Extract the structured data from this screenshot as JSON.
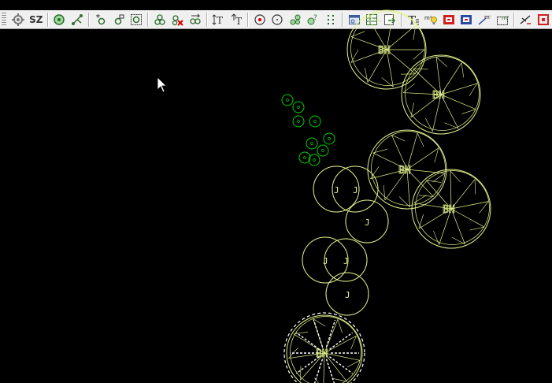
{
  "toolbar": {
    "sz_label": "SZ",
    "buttons": [
      "settings-icon",
      "sz-text",
      "green-circle-icon",
      "branch-icon",
      "tree-add-icon",
      "tree-edit-icon",
      "tree-frame-icon",
      "tree-group-icon",
      "tree-delete-icon",
      "tree-move-icon",
      "text-height-icon",
      "text-width-icon",
      "circle-red-icon",
      "circle-plain-icon",
      "tree-cluster-icon",
      "tree-help-icon",
      "grid-icon",
      "window-icon",
      "table-icon",
      "export-icon",
      "text-style-icon",
      "area-bulb-icon",
      "red-block-icon",
      "blue-block-icon",
      "area-line-icon",
      "area-box-icon",
      "cut-icon",
      "red-frame-icon"
    ]
  },
  "colors": {
    "canvas_bg": "#000000",
    "tree_outline": "#e4f28c",
    "shrub_outline": "#00d000",
    "toolbar_bg": "#f0f0f0"
  },
  "drawing": {
    "tree_label": "BH",
    "small_plant_label": "J"
  }
}
